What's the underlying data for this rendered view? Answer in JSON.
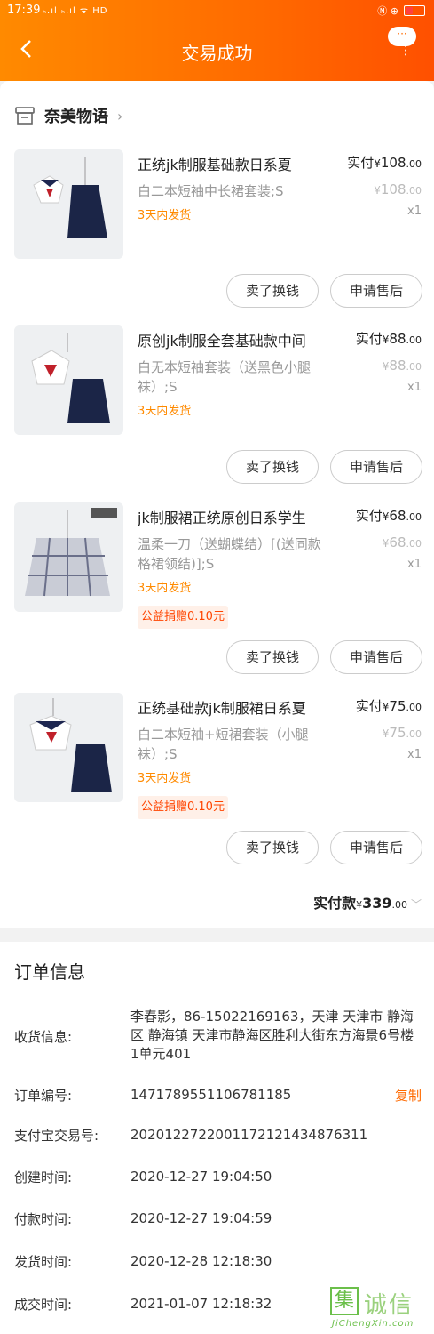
{
  "status_bar": {
    "time": "17:39",
    "left_icons": "ₕ.ıl ₕ.ıl ᯤ HD",
    "right_icons": "Ⓝ ⊕"
  },
  "header": {
    "title": "交易成功",
    "back_icon": "back-arrow-icon",
    "more_bubble": "···",
    "more_dots": "⋮"
  },
  "shop": {
    "name": "奈美物语",
    "icon": "store-icon",
    "arrow": "›"
  },
  "items": [
    {
      "name": "正统jk制服基础款日系夏",
      "spec": "白二本短袖中长裙套装;S",
      "ship": "3天内发货",
      "charity": "",
      "paid_label": "实付",
      "yen": "¥",
      "price_int": "108",
      "price_dec": ".00",
      "orig_int": "108",
      "orig_dec": ".00",
      "qty": "x1",
      "btn_sell": "卖了换钱",
      "btn_after": "申请售后"
    },
    {
      "name": "原创jk制服全套基础款中间",
      "spec": "白无本短袖套装（送黑色小腿袜）;S",
      "ship": "3天内发货",
      "charity": "",
      "paid_label": "实付",
      "yen": "¥",
      "price_int": "88",
      "price_dec": ".00",
      "orig_int": "88",
      "orig_dec": ".00",
      "qty": "x1",
      "btn_sell": "卖了换钱",
      "btn_after": "申请售后"
    },
    {
      "name": "jk制服裙正统原创日系学生",
      "spec": "温柔一刀（送蝴蝶结）[(送同款格裙领结)];S",
      "ship": "3天内发货",
      "charity": "公益捐赠0.10元",
      "paid_label": "实付",
      "yen": "¥",
      "price_int": "68",
      "price_dec": ".00",
      "orig_int": "68",
      "orig_dec": ".00",
      "qty": "x1",
      "btn_sell": "卖了换钱",
      "btn_after": "申请售后"
    },
    {
      "name": "正统基础款jk制服裙日系夏",
      "spec": "白二本短袖+短裙套装（小腿袜）;S",
      "ship": "3天内发货",
      "charity": "公益捐赠0.10元",
      "paid_label": "实付",
      "yen": "¥",
      "price_int": "75",
      "price_dec": ".00",
      "orig_int": "75",
      "orig_dec": ".00",
      "qty": "x1",
      "btn_sell": "卖了换钱",
      "btn_after": "申请售后"
    }
  ],
  "total": {
    "label": "实付款",
    "yen": "¥",
    "int": "339",
    "dec": ".00",
    "chevron": "﹀"
  },
  "order_info": {
    "title": "订单信息",
    "rows": [
      {
        "label": "收货信息:",
        "value": "李春影，86-15022169163，天津 天津市 静海区 静海镇 天津市静海区胜利大街东方海景6号楼1单元401"
      },
      {
        "label": "订单编号:",
        "value": "1471789551106781185",
        "action": "复制"
      },
      {
        "label": "支付宝交易号:",
        "value": "2020122722001172121434876311"
      },
      {
        "label": "创建时间:",
        "value": "2020-12-27 19:04:50"
      },
      {
        "label": "付款时间:",
        "value": "2020-12-27 19:04:59"
      },
      {
        "label": "发货时间:",
        "value": "2020-12-28 12:18:30"
      },
      {
        "label": "成交时间:",
        "value": "2021-01-07 12:18:32"
      }
    ]
  },
  "watermark": {
    "mark": "集",
    "text": "诚信",
    "url": "JiChengXin.com"
  },
  "colors": {
    "accent": "#ff6a00",
    "ship": "#ff8a00",
    "charity": "#ff4400"
  }
}
